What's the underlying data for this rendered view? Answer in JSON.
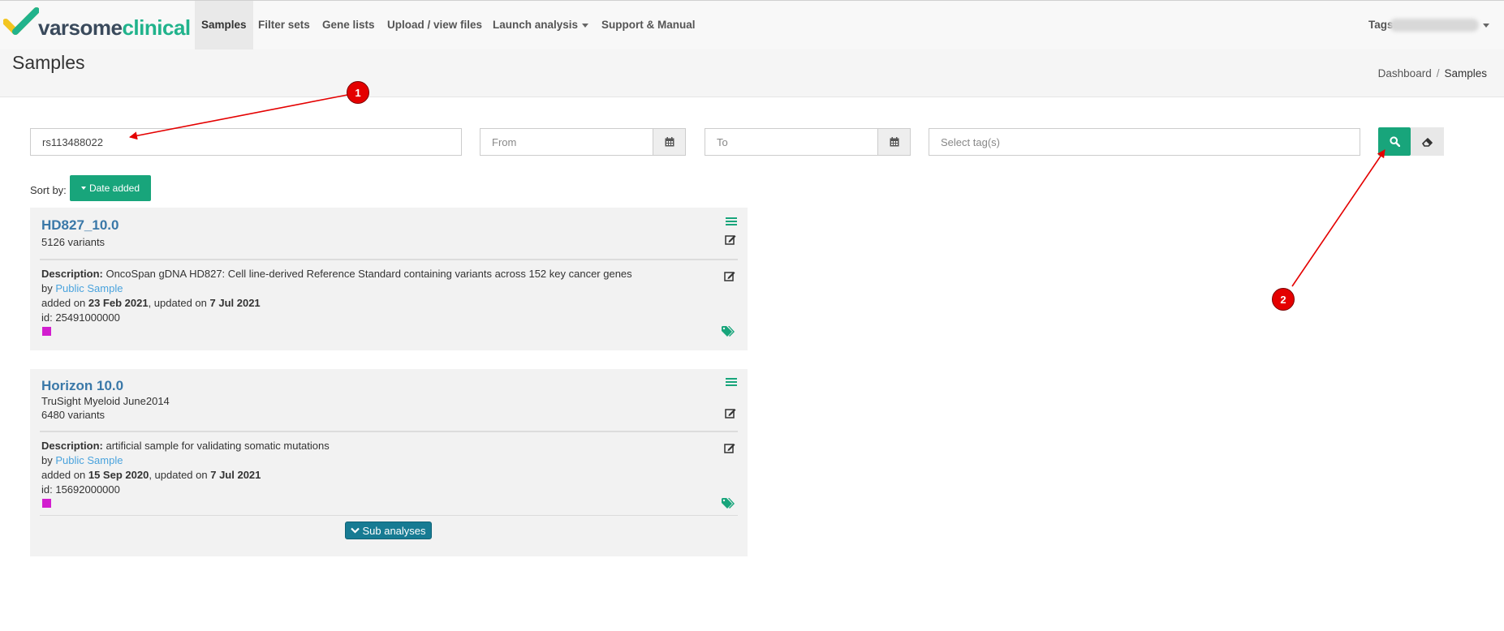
{
  "nav": {
    "logo_part1": "varsome",
    "logo_part2": "clinical",
    "items": [
      {
        "label": "Samples"
      },
      {
        "label": "Filter sets"
      },
      {
        "label": "Gene lists"
      },
      {
        "label": "Upload / view files"
      },
      {
        "label": "Launch analysis"
      },
      {
        "label": "Support & Manual"
      }
    ],
    "tags_label": "Tags"
  },
  "page": {
    "title": "Samples",
    "breadcrumb": [
      {
        "label": "Dashboard"
      },
      {
        "label": "Samples"
      }
    ]
  },
  "filters": {
    "search_value": "rs113488022",
    "from_placeholder": "From",
    "to_placeholder": "To",
    "tags_placeholder": "Select tag(s)"
  },
  "sort": {
    "label": "Sort by:",
    "button_label": "Date added"
  },
  "samples": [
    {
      "name": "HD827_10.0",
      "variants": "5126 variants",
      "description_label": "Description:",
      "description": "OncoSpan gDNA HD827: Cell line-derived Reference Standard containing variants across 152 key cancer genes",
      "by_label": "by",
      "owner": "Public Sample",
      "added_label": "added on",
      "added": "23 Feb 2021",
      "updated_label": ", updated on",
      "updated": "7 Jul 2021",
      "id_text": "id: 25491000000",
      "tag_color": "#d21ecf"
    },
    {
      "name": "Horizon 10.0",
      "subtitle": "TruSight Myeloid June2014",
      "variants": "6480 variants",
      "description_label": "Description:",
      "description": "artificial sample for validating somatic mutations",
      "by_label": "by",
      "owner": "Public Sample",
      "added_label": "added on",
      "added": "15 Sep 2020",
      "updated_label": ", updated on",
      "updated": "7 Jul 2021",
      "id_text": "id: 15692000000",
      "tag_color": "#d21ecf",
      "sub_analyses_label": "Sub analyses"
    }
  ],
  "annotations": [
    {
      "label": "1"
    },
    {
      "label": "2"
    }
  ],
  "colors": {
    "accent": "#18a57b",
    "link": "#4aa3dd",
    "title": "#3a78a8",
    "annotation": "#e40000"
  }
}
